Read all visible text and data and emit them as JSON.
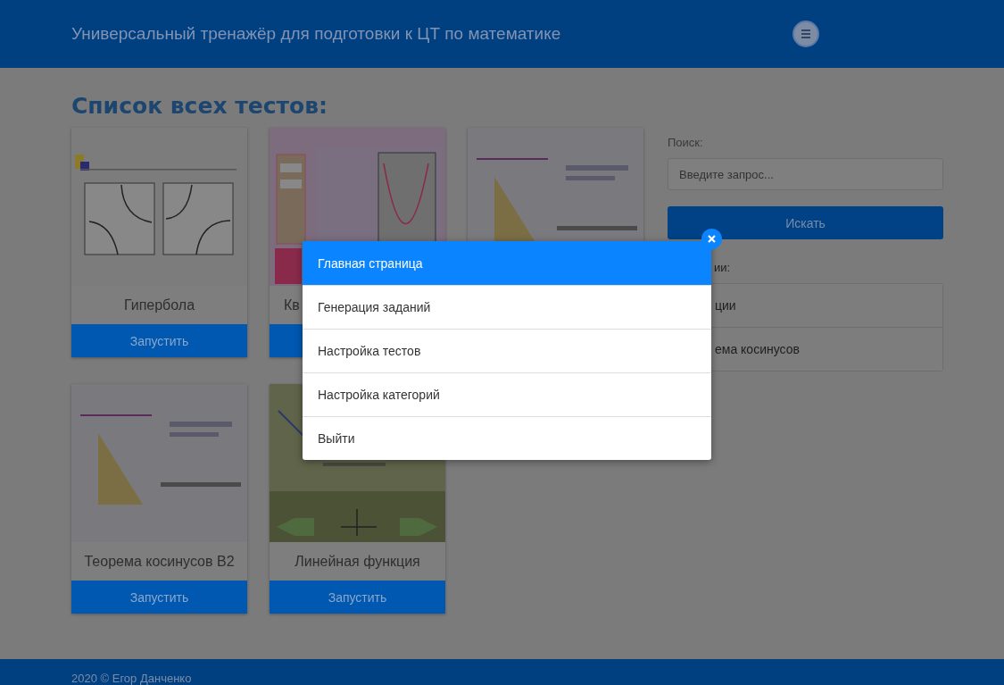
{
  "header": {
    "title": "Универсальный тренажёр для подготовки к ЦТ по математике"
  },
  "heading": "Список всех тестов:",
  "cards": [
    {
      "kind": "full",
      "title": "Гипербола",
      "button": "Запустить"
    },
    {
      "kind": "covered",
      "title": "Кв"
    },
    {
      "kind": "picture-only"
    },
    {
      "kind": "full",
      "title": "Теорема косинусов B2",
      "button": "Запустить"
    },
    {
      "kind": "full",
      "title": "Линейная функция",
      "button": "Запустить"
    }
  ],
  "sidebar": {
    "search_label": "Поиск:",
    "search": {
      "placeholder": "Введите запрос..."
    },
    "search_button": "Искать",
    "categories_label": "ии:",
    "categories": [
      "ции",
      "ема косинусов"
    ]
  },
  "menu": {
    "items": [
      {
        "label": "Главная страница",
        "selected": true
      },
      {
        "label": "Генерация заданий",
        "selected": false
      },
      {
        "label": "Настройка тестов",
        "selected": false
      },
      {
        "label": "Настройка категорий",
        "selected": false
      },
      {
        "label": "Выйти",
        "selected": false
      }
    ]
  },
  "footer": {
    "text": "2020 © Егор Данченко"
  }
}
